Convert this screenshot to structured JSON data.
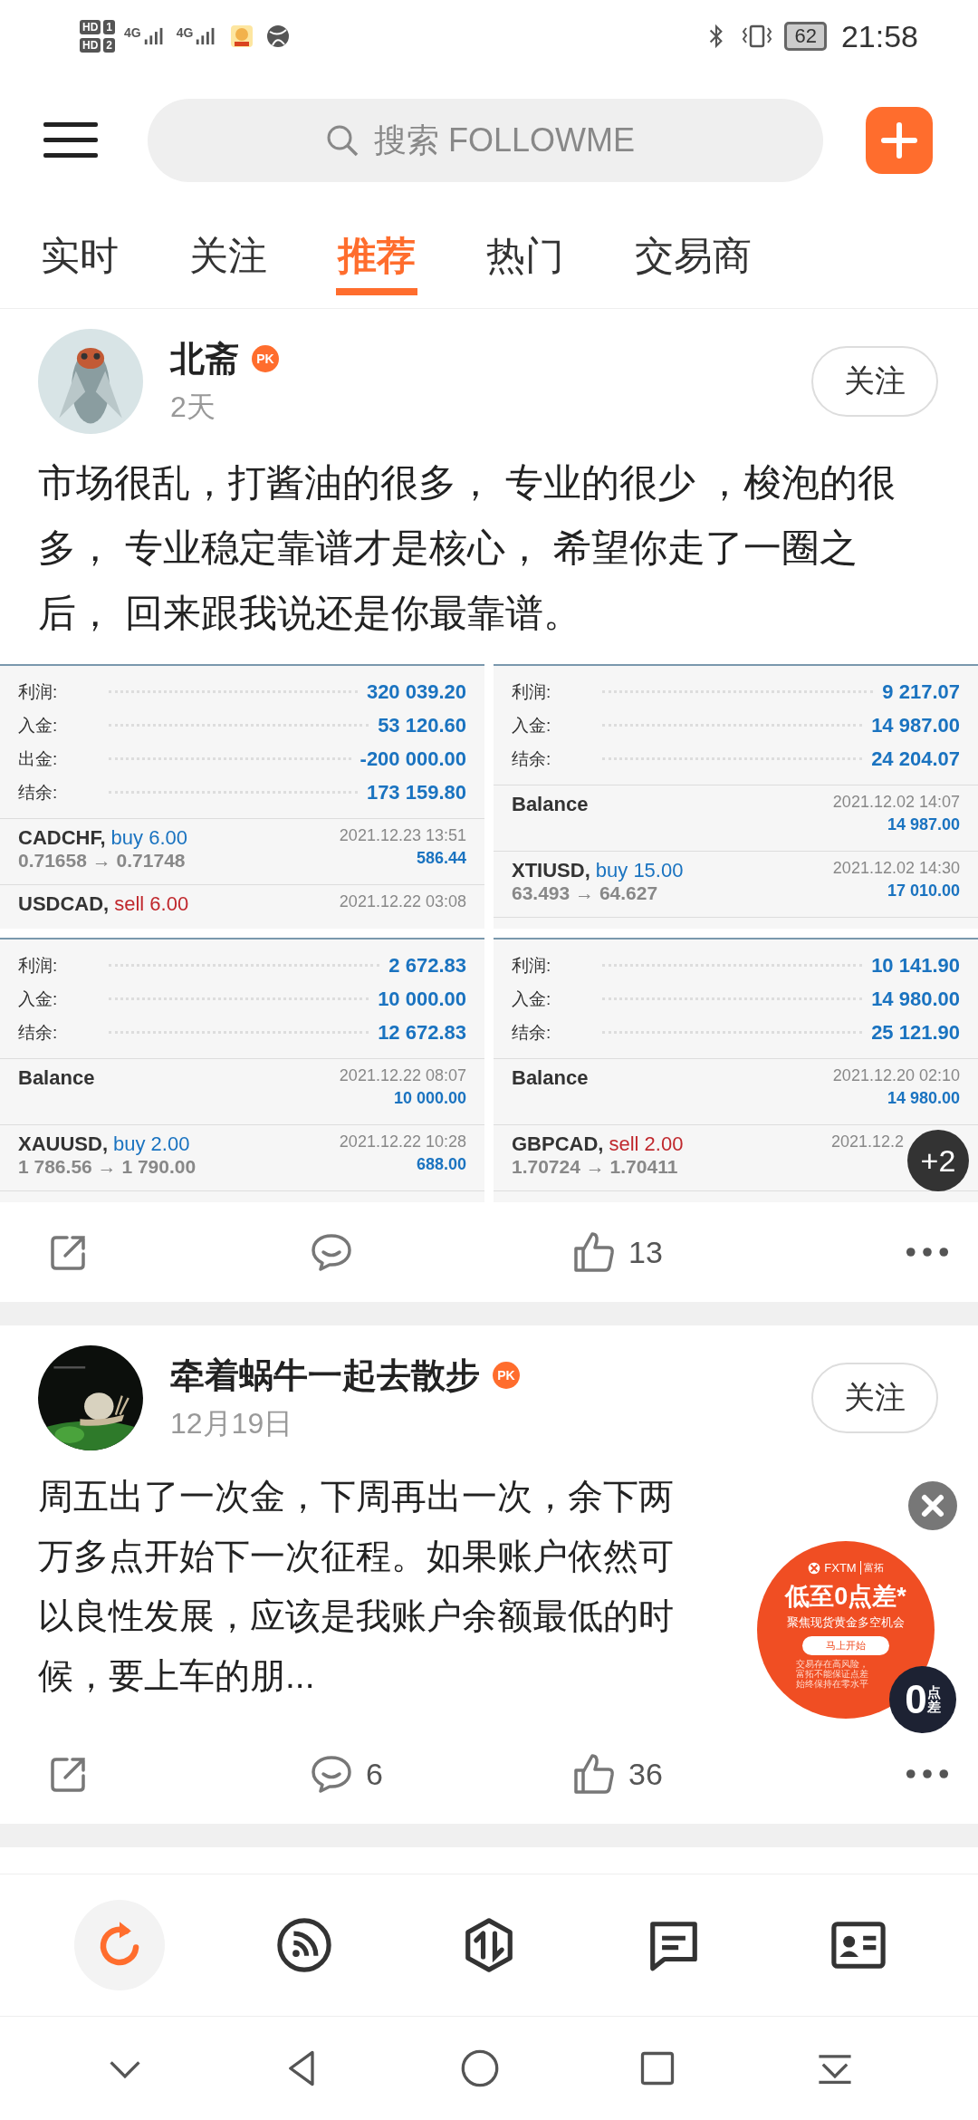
{
  "status_bar": {
    "sims": [
      {
        "label": "HD",
        "slot": "1"
      },
      {
        "label": "HD",
        "slot": "2"
      }
    ],
    "networks": [
      "4G",
      "4G"
    ],
    "battery": "62",
    "time": "21:58"
  },
  "search": {
    "placeholder": "搜索 FOLLOWME"
  },
  "tabs": [
    {
      "label": "实时",
      "selected": false
    },
    {
      "label": "关注",
      "selected": false
    },
    {
      "label": "推荐",
      "selected": true
    },
    {
      "label": "热门",
      "selected": false
    },
    {
      "label": "交易商",
      "selected": false
    }
  ],
  "posts": [
    {
      "author": "北斋",
      "badge": "PK",
      "time": "2天",
      "follow": "关注",
      "text": "市场很乱，打酱油的很多， 专业的很少 ，梭泡的很多， 专业稳定靠谱才是核心， 希望你走了一圈之后， 回来跟我说还是你最靠谱。",
      "more_count": "+2",
      "cards": [
        {
          "summary": [
            {
              "label": "利润:",
              "value": "320 039.20"
            },
            {
              "label": "入金:",
              "value": "53 120.60"
            },
            {
              "label": "出金:",
              "value": "-200 000.00"
            },
            {
              "label": "结余:",
              "value": "173 159.80"
            }
          ],
          "entries": [
            {
              "kind": "trade",
              "symbol": "CADCHF,",
              "order": "buy 6.00",
              "sell": false,
              "prices": "0.71658 → 0.71748",
              "date": "2021.12.23 13:51",
              "amount": "586.44"
            },
            {
              "kind": "trade",
              "symbol": "USDCAD,",
              "order": "sell 6.00",
              "sell": true,
              "date": "2021.12.22 03:08"
            }
          ]
        },
        {
          "summary": [
            {
              "label": "利润:",
              "value": "9 217.07"
            },
            {
              "label": "入金:",
              "value": "14 987.00"
            },
            {
              "label": "结余:",
              "value": "24 204.07"
            }
          ],
          "entries": [
            {
              "kind": "balance",
              "title": "Balance",
              "date": "2021.12.02 14:07",
              "amount": "14 987.00"
            },
            {
              "kind": "trade",
              "symbol": "XTIUSD,",
              "order": "buy 15.00",
              "sell": false,
              "prices": "63.493 → 64.627",
              "date": "2021.12.02 14:30",
              "amount": "17 010.00"
            }
          ]
        },
        {
          "summary": [
            {
              "label": "利润:",
              "value": "2 672.83"
            },
            {
              "label": "入金:",
              "value": "10 000.00"
            },
            {
              "label": "结余:",
              "value": "12 672.83"
            }
          ],
          "entries": [
            {
              "kind": "balance",
              "title": "Balance",
              "date": "2021.12.22 08:07",
              "amount": "10 000.00"
            },
            {
              "kind": "trade",
              "symbol": "XAUUSD,",
              "order": "buy 2.00",
              "sell": false,
              "prices": "1 786.56 → 1 790.00",
              "date": "2021.12.22 10:28",
              "amount": "688.00"
            }
          ]
        },
        {
          "summary": [
            {
              "label": "利润:",
              "value": "10 141.90"
            },
            {
              "label": "入金:",
              "value": "14 980.00"
            },
            {
              "label": "结余:",
              "value": "25 121.90"
            }
          ],
          "entries": [
            {
              "kind": "balance",
              "title": "Balance",
              "date": "2021.12.20 02:10",
              "amount": "14 980.00"
            },
            {
              "kind": "trade",
              "symbol": "GBPCAD,",
              "order": "sell 2.00",
              "sell": true,
              "prices": "1.70724 → 1.70411",
              "date": "2021.12.2"
            }
          ]
        }
      ],
      "likes": "13"
    },
    {
      "author": "牵着蜗牛一起去散步",
      "badge": "PK",
      "time": "12月19日",
      "follow": "关注",
      "text": "周五出了一次金，下周再出一次，余下两万多点开始下一次征程。如果账户依然可以良性发展，应该是我账户余额最低的时候，要上车的朋...",
      "comments": "6",
      "likes": "36"
    }
  ],
  "ad": {
    "brand": "FXTM",
    "brand_cn": "富拓",
    "headline": "低至0点差*",
    "subtitle": "聚焦现货黄金多空机会",
    "cta": "马上开始",
    "disclaimer": [
      "交易存在高风险，",
      "富拓不能保证点差",
      "始终保持在零水平"
    ],
    "badge_number": "0",
    "badge_text": "点差"
  },
  "bottom_nav": [
    {
      "kind": "refresh",
      "selected": true
    },
    {
      "kind": "feed",
      "selected": false
    },
    {
      "kind": "exchange",
      "selected": false
    },
    {
      "kind": "message",
      "selected": false
    },
    {
      "kind": "profile",
      "selected": false
    }
  ]
}
